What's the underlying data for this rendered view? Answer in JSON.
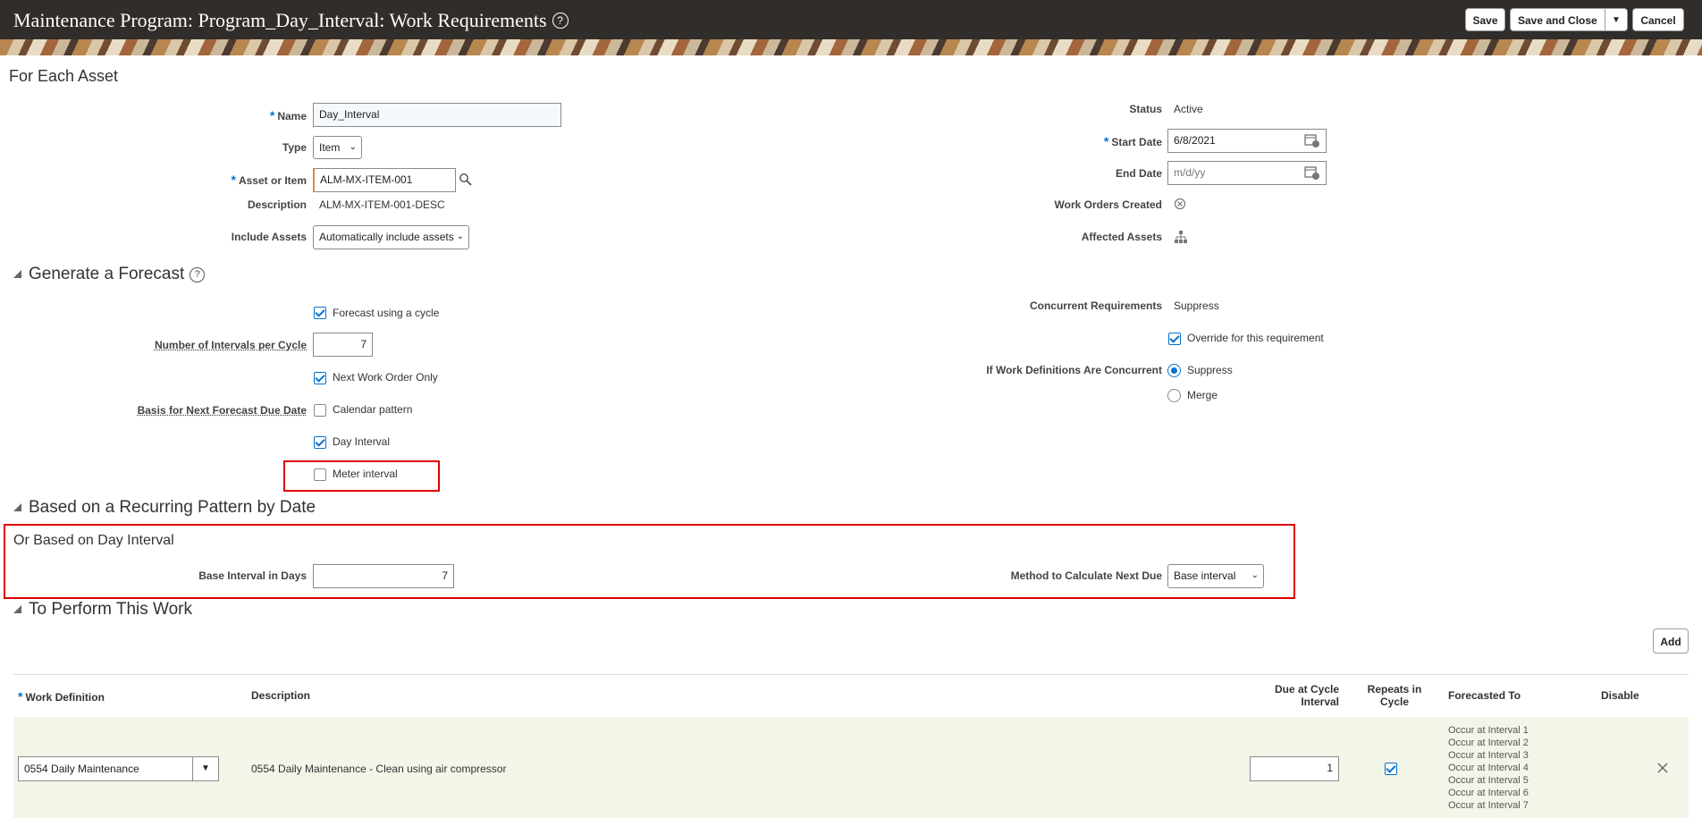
{
  "header": {
    "title": "Maintenance Program: Program_Day_Interval: Work Requirements",
    "help": "?",
    "save_label": "Save",
    "save_close_label": "Save and Close",
    "cancel_label": "Cancel"
  },
  "for_each_asset": {
    "heading": "For Each Asset",
    "name_label": "Name",
    "name_value": "Day_Interval",
    "type_label": "Type",
    "type_value": "Item",
    "asset_item_label": "Asset or Item",
    "asset_item_value": "ALM-MX-ITEM-001",
    "description_label": "Description",
    "description_value": "ALM-MX-ITEM-001-DESC",
    "include_assets_label": "Include Assets",
    "include_assets_value": "Automatically include assets",
    "status_label": "Status",
    "status_value": "Active",
    "start_date_label": "Start Date",
    "start_date_value": "6/8/2021",
    "end_date_label": "End Date",
    "end_date_placeholder": "m/d/yy",
    "work_orders_created_label": "Work Orders Created",
    "affected_assets_label": "Affected Assets"
  },
  "forecast": {
    "heading": "Generate a Forecast",
    "forecast_cycle_label": "Forecast using a cycle",
    "forecast_cycle_checked": true,
    "intervals_label": "Number of Intervals per Cycle",
    "intervals_value": "7",
    "next_wo_only_label": "Next Work Order Only",
    "next_wo_only_checked": true,
    "basis_label": "Basis for Next Forecast Due Date",
    "calendar_pattern_label": "Calendar pattern",
    "calendar_pattern_checked": false,
    "day_interval_label": "Day Interval",
    "day_interval_checked": true,
    "meter_interval_label": "Meter interval",
    "meter_interval_checked": false,
    "concurrent_label": "Concurrent Requirements",
    "concurrent_value": "Suppress",
    "override_label": "Override for this requirement",
    "override_checked": true,
    "if_concurrent_label": "If Work Definitions Are Concurrent",
    "suppress_label": "Suppress",
    "merge_label": "Merge"
  },
  "recurring": {
    "heading": "Based on a Recurring Pattern by Date"
  },
  "day_interval": {
    "heading": "Or Based on Day Interval",
    "base_interval_label": "Base Interval in Days",
    "base_interval_value": "7",
    "method_label": "Method to Calculate Next Due",
    "method_value": "Base interval"
  },
  "perform_work": {
    "heading": "To Perform This Work",
    "add_label": "Add",
    "columns": {
      "work_definition": "Work Definition",
      "description": "Description",
      "due_at_line1": "Due at Cycle",
      "due_at_line2": "Interval",
      "repeats_line1": "Repeats in",
      "repeats_line2": "Cycle",
      "forecasted_to": "Forecasted To",
      "disable": "Disable"
    },
    "row": {
      "work_definition": "0554 Daily Maintenance",
      "description": "0554 Daily Maintenance - Clean using air compressor",
      "due_at": "1",
      "repeats": true,
      "forecasted": [
        "Occur at Interval 1",
        "Occur at Interval 2",
        "Occur at Interval 3",
        "Occur at Interval 4",
        "Occur at Interval 5",
        "Occur at Interval 6",
        "Occur at Interval 7"
      ]
    }
  }
}
